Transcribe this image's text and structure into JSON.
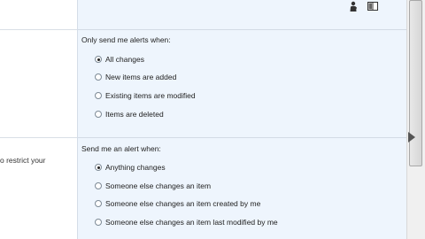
{
  "left": {
    "description_fragment": "o restrict your"
  },
  "section_only_send": {
    "label": "Only send me alerts when:",
    "options": [
      {
        "label": "All changes",
        "checked": true
      },
      {
        "label": "New items are added",
        "checked": false
      },
      {
        "label": "Existing items are modified",
        "checked": false
      },
      {
        "label": "Items are deleted",
        "checked": false
      }
    ]
  },
  "section_send_alert": {
    "label": "Send me an alert when:",
    "options": [
      {
        "label": "Anything changes",
        "checked": true
      },
      {
        "label": "Someone else changes an item",
        "checked": false
      },
      {
        "label": "Someone else changes an item created by me",
        "checked": false
      },
      {
        "label": "Someone else changes an item last modified by me",
        "checked": false
      }
    ]
  },
  "icons": {
    "person": "person-icon",
    "book": "book-icon"
  },
  "colors": {
    "panel_bg": "#eef5fd",
    "separator": "#d3dbe5"
  }
}
